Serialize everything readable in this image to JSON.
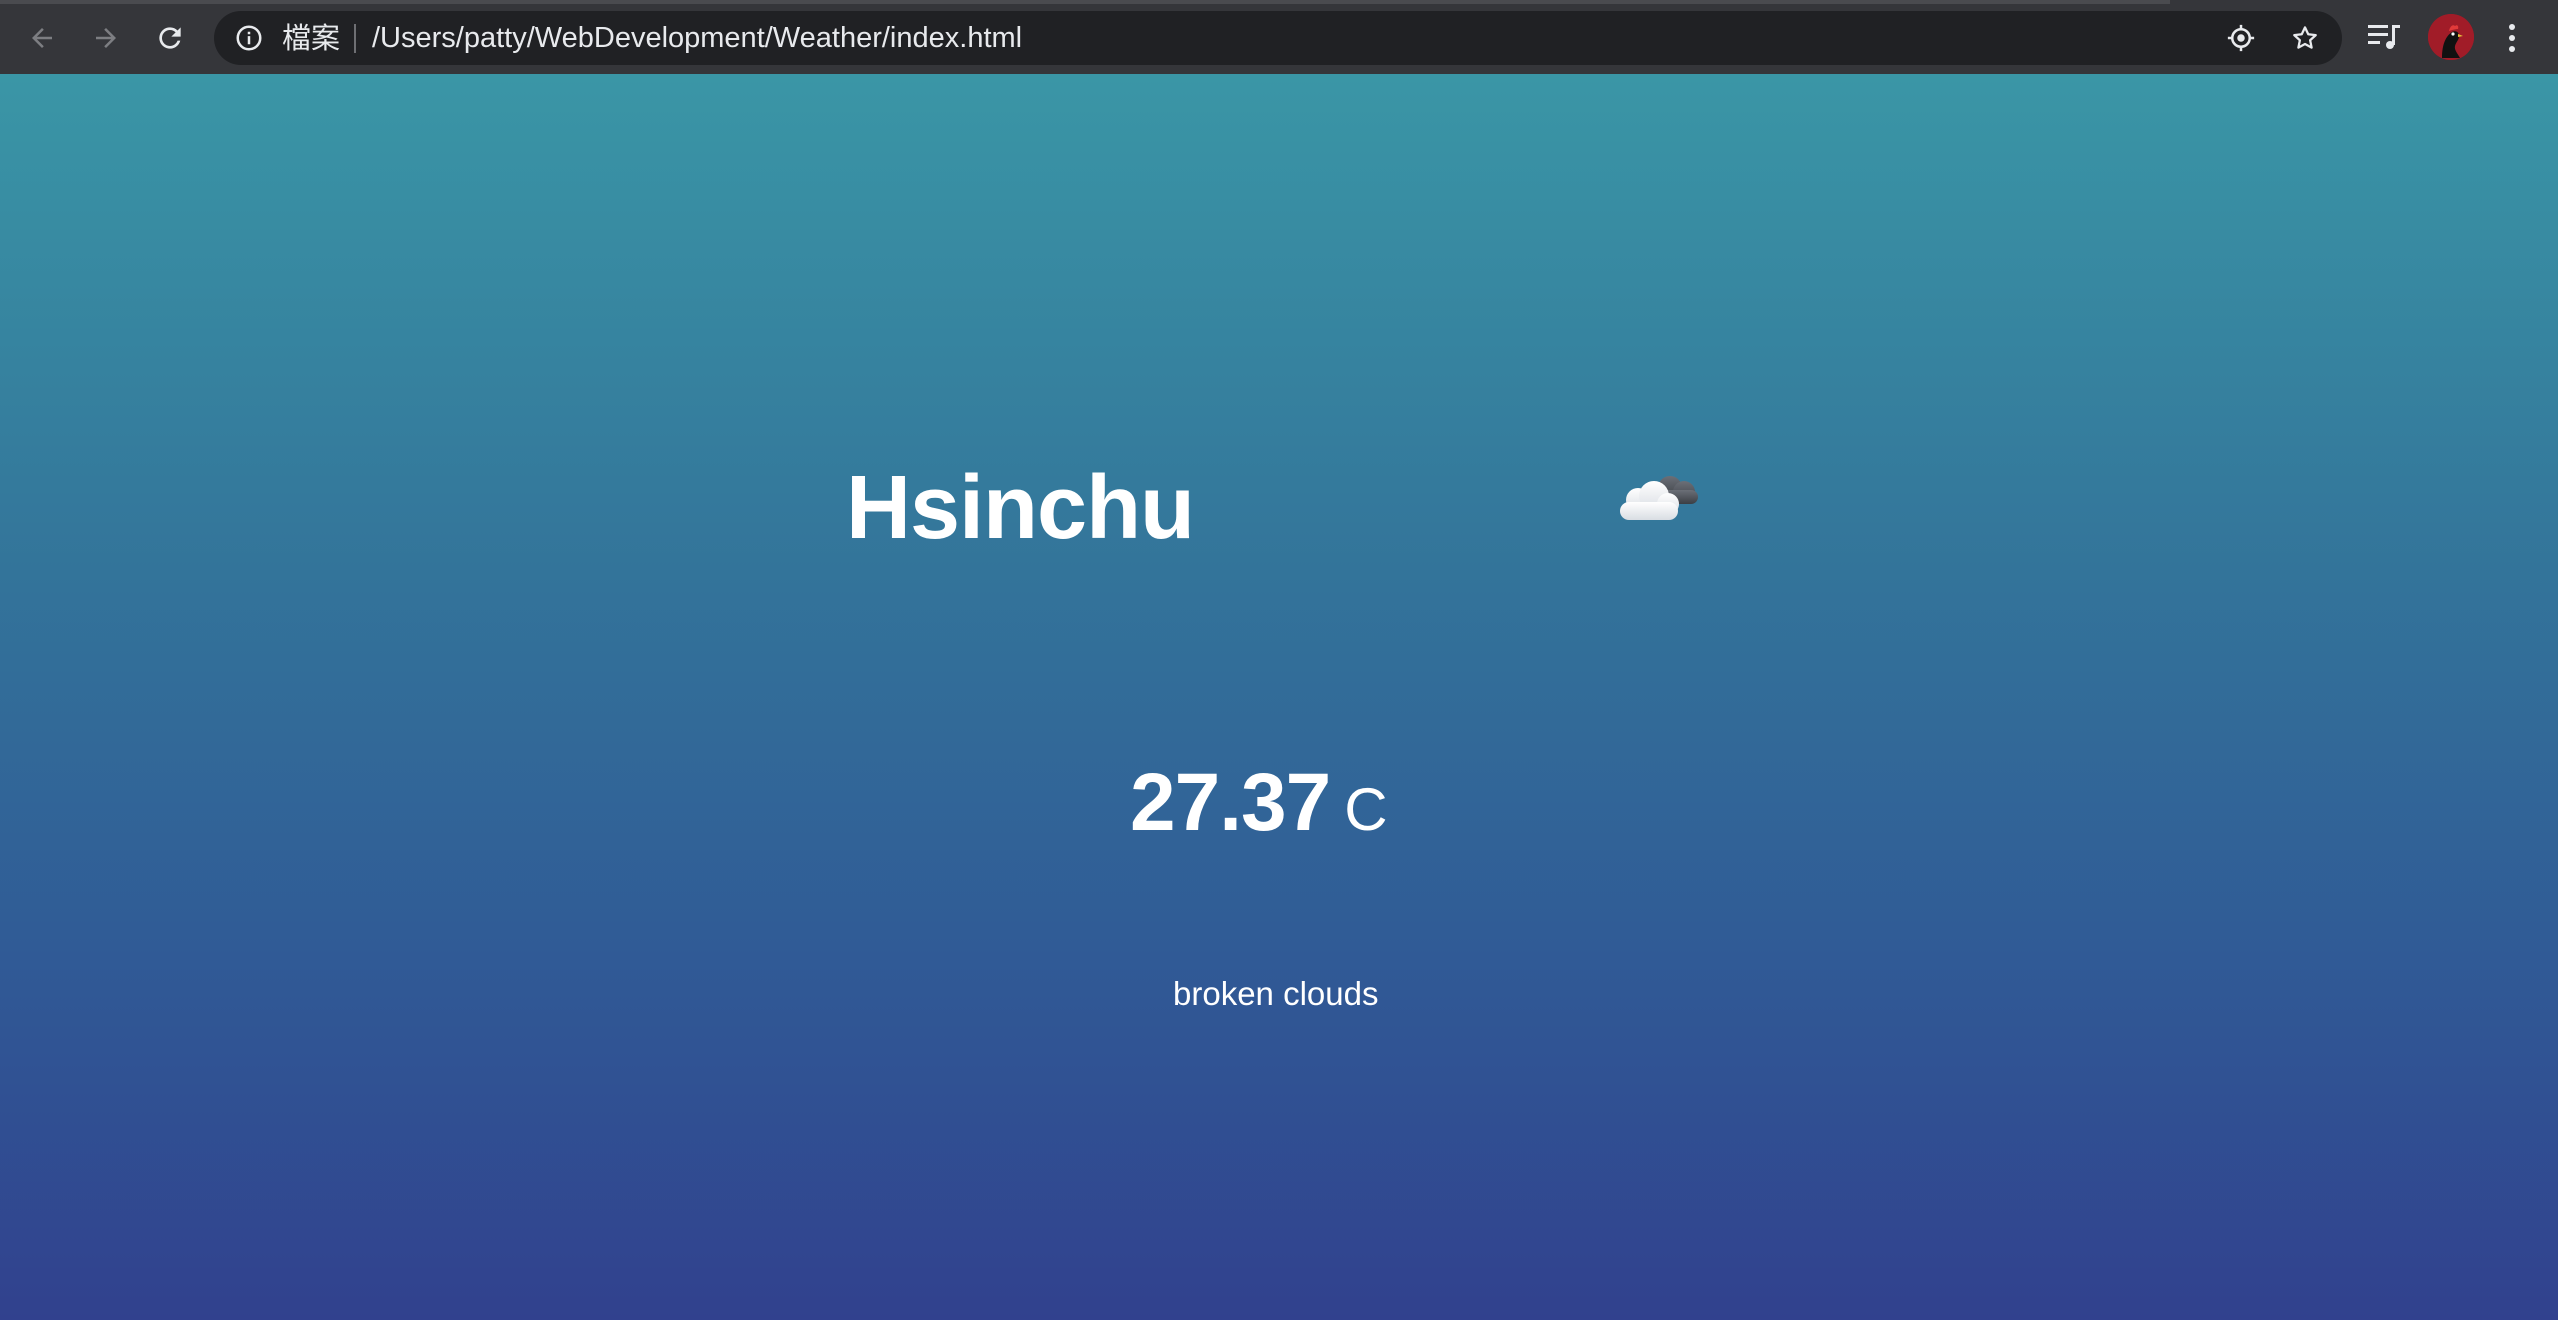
{
  "browser": {
    "site_chip": "檔案",
    "url": "/Users/patty/WebDevelopment/Weather/index.html",
    "icons": {
      "back": "back-arrow-icon",
      "forward": "forward-arrow-icon",
      "reload": "reload-icon",
      "info": "info-icon",
      "location": "location-icon",
      "bookmark": "star-icon",
      "media": "media-control-icon",
      "profile": "avatar",
      "menu": "kebab-menu-icon"
    }
  },
  "weather": {
    "city": "Hsinchu",
    "temperature": "27.37",
    "unit": "C",
    "description": "broken clouds",
    "icon": "broken-clouds-icon"
  },
  "colors": {
    "gradient_top": "#3a96a6",
    "gradient_bottom": "#31418e",
    "text": "#ffffff",
    "toolbar": "#35363a"
  }
}
